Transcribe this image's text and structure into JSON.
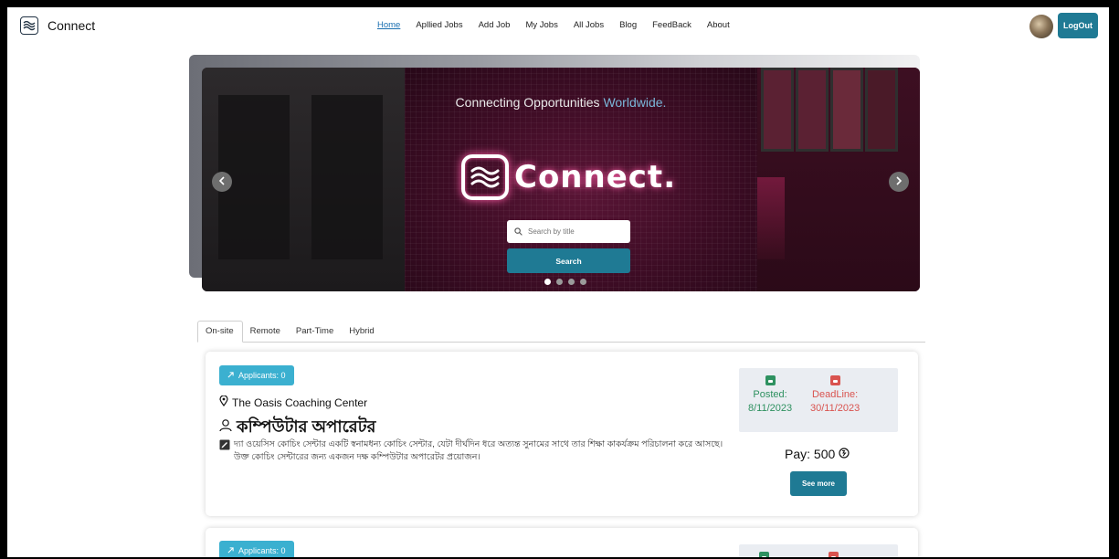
{
  "app": {
    "name": "Connect"
  },
  "nav": {
    "links": [
      "Home",
      "Apllied Jobs",
      "Add Job",
      "My Jobs",
      "All Jobs",
      "Blog",
      "FeedBack",
      "About"
    ],
    "active": "Home",
    "logout_label": "LogOut"
  },
  "hero": {
    "tagline_main": "Connecting Opportunities",
    "tagline_accent": "Worldwide.",
    "logo_text": "Connect.",
    "search_placeholder": "Search by title",
    "search_button": "Search",
    "slide_count": 4,
    "active_slide": 1
  },
  "tabs": [
    "On-site",
    "Remote",
    "Part-Time",
    "Hybrid"
  ],
  "jobs": [
    {
      "applicants_label": "Applicants: 0",
      "company": "The Oasis Coaching Center",
      "title": "কম্পিউটার অপারেটর",
      "description": "দ্যা ওয়েসিস কোচিং সেন্টার একটি স্বনামধন্য কোচিং সেন্টার, যেটা দীর্ঘদিন ধরে অত্যন্ত সুনামের সাথে তার শিক্ষা কাকর্যক্রম পরিচালনা করে আসছে। উক্ত কোচিং সেন্টারের জন্য একজন দক্ষ কম্পিউটার অপারেটর প্রয়োজন।",
      "posted_label": "Posted:",
      "posted_date": "8/11/2023",
      "deadline_label": "DeadLine:",
      "deadline_date": "30/11/2023",
      "pay": "Pay: 500",
      "see_more": "See more"
    },
    {
      "applicants_label": "Applicants: 0"
    }
  ],
  "colors": {
    "primary": "#1f7a94",
    "badge": "#3bb0d0",
    "posted": "#2e9160",
    "deadline": "#d9534f",
    "accent_text": "#7ab6d9"
  }
}
